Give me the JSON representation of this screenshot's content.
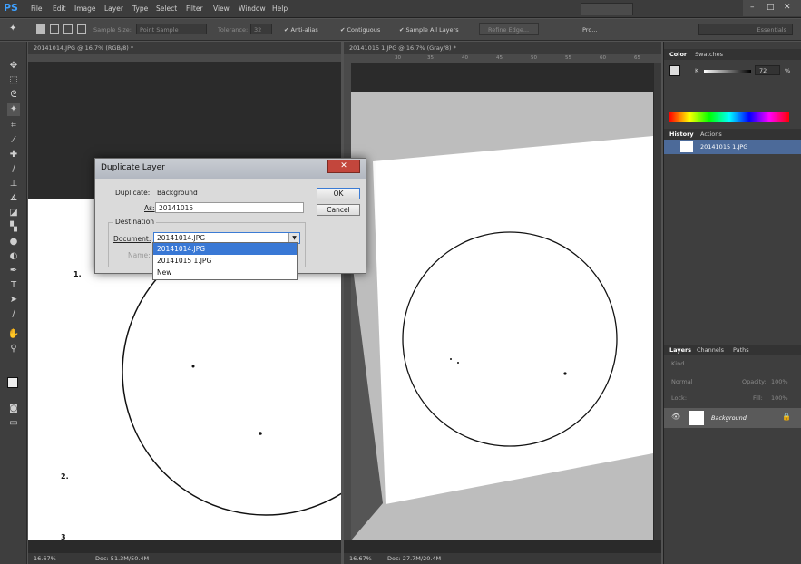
{
  "app": {
    "logo": "PS"
  },
  "menu": [
    "File",
    "Edit",
    "Image",
    "Layer",
    "Type",
    "Select",
    "Filter",
    "View",
    "Window",
    "Help"
  ],
  "window_controls": {
    "minimize": "–",
    "maximize": "□",
    "close": "✕"
  },
  "options_bar": {
    "sample_size_label": "Sample Size:",
    "sample_size_value": "Point Sample",
    "tolerance_label": "Tolerance:",
    "tolerance_value": "32",
    "anti_alias": "Anti-alias",
    "contiguous": "Contiguous",
    "sample_all_layers": "Sample All Layers",
    "refine_edge": "Refine Edge...",
    "pro_label": "Pro...",
    "workspace": "Essentials"
  },
  "doc_a": {
    "tab": "20141014.JPG @ 16.7% (RGB/8) *",
    "zoom": "16.67%",
    "doc_size": "Doc: 51.3M/50.4M",
    "labels": [
      "1.",
      "2.",
      "3"
    ]
  },
  "doc_b": {
    "tab": "20141015 1.JPG @ 16.7% (Gray/8) *",
    "zoom": "16.67%",
    "doc_size": "Doc: 27.7M/20.4M",
    "ruler_ticks": [
      "30",
      "35",
      "40",
      "45",
      "50",
      "55",
      "60",
      "65"
    ]
  },
  "color_panel": {
    "tabs": [
      "Color",
      "Swatches"
    ],
    "k_label": "K",
    "k_value": "72",
    "percent": "%"
  },
  "history_panel": {
    "tabs": [
      "History",
      "Actions"
    ],
    "item": "20141015 1.JPG"
  },
  "layers_panel": {
    "tabs": [
      "Layers",
      "Channels",
      "Paths"
    ],
    "kind": "Kind",
    "blend": "Normal",
    "opacity_label": "Opacity:",
    "opacity_value": "100%",
    "lock_label": "Lock:",
    "fill_label": "Fill:",
    "fill_value": "100%",
    "layer_name": "Background"
  },
  "dialog": {
    "title": "Duplicate Layer",
    "close": "✕",
    "duplicate_label": "Duplicate:",
    "duplicate_value": "Background",
    "as_label": "As:",
    "as_value": "20141015",
    "destination_label": "Destination",
    "document_label": "Document:",
    "document_value": "20141014.JPG",
    "name_label": "Name:",
    "ok": "OK",
    "cancel": "Cancel",
    "options": [
      "20141014.JPG",
      "20141015 1.JPG",
      "New"
    ],
    "selected_option": "20141014.JPG"
  }
}
